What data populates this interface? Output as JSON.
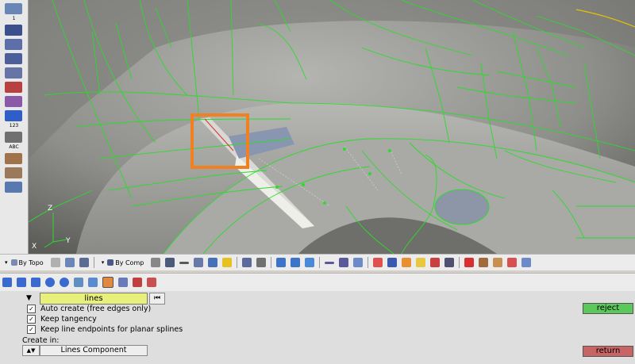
{
  "viewport": {
    "axis": {
      "z": "Z",
      "x": "X",
      "y": "Y"
    }
  },
  "left_toolbar": {
    "labels": [
      "1",
      "123",
      "ABC"
    ]
  },
  "toolbar1": {
    "by_topo": "By Topo",
    "by_comp": "By Comp"
  },
  "panel": {
    "entity_selector": "lines",
    "options": [
      {
        "label": "Auto create (free edges only)",
        "checked": true
      },
      {
        "label": "Keep tangency",
        "checked": true
      },
      {
        "label": "Keep line endpoints for planar splines",
        "checked": true
      }
    ],
    "create_in_label": "Create in:",
    "component_button": "Lines Component",
    "reject_button": "reject",
    "return_button": "return"
  },
  "colors": {
    "mesh_edge": "#2bdc2b",
    "highlight_box": "#f08020",
    "reject_bg": "#5cc85c",
    "return_bg": "#c86464",
    "entity_field": "#e6f07a"
  }
}
